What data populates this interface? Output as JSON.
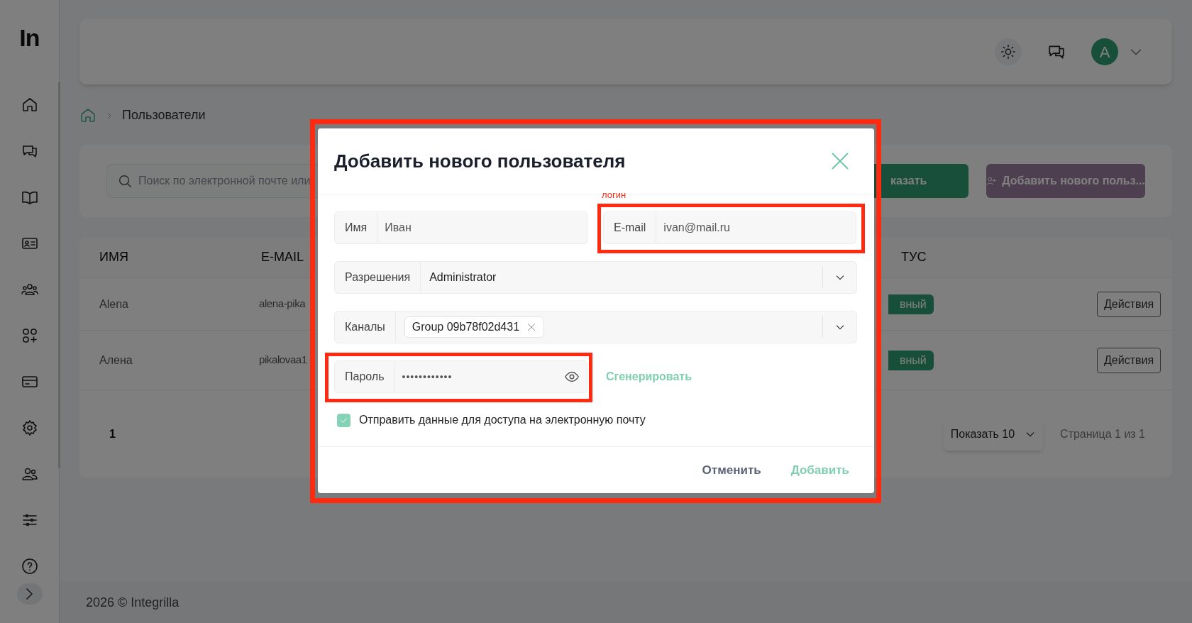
{
  "logo": "In",
  "breadcrumb": {
    "current": "Пользователи"
  },
  "filters": {
    "search_placeholder": "Поиск по электронной почте или",
    "show_button": "казать",
    "add_button": "Добавить нового польз..."
  },
  "table": {
    "columns": [
      "ИМЯ",
      "E-MAIL",
      "ТУС"
    ],
    "rows": [
      {
        "name": "Alena",
        "email": "alena-pika",
        "status": "вный",
        "action": "Действия"
      },
      {
        "name": "Алена",
        "email": "pikalovaa1",
        "status": "вный",
        "action": "Действия"
      }
    ],
    "pagination": {
      "page": "1",
      "page_size": "Показать 10",
      "page_info": "Страница 1 из 1"
    }
  },
  "header": {
    "avatar_letter": "A"
  },
  "footer": "2026 © Integrilla",
  "modal": {
    "title": "Добавить нового пользователя",
    "name": {
      "label": "Имя",
      "value": "Иван"
    },
    "email": {
      "label": "E-mail",
      "value": "ivan@mail.ru"
    },
    "permissions": {
      "label": "Разрешения",
      "value": "Administrator"
    },
    "channels": {
      "label": "Каналы",
      "tags": [
        "Group 09b78f02d431"
      ]
    },
    "password": {
      "label": "Пароль",
      "value": "••••••••••••"
    },
    "generate": "Сгенерировать",
    "send_email": {
      "label": "Отправить данные для доступа на электронную почту",
      "checked": true
    },
    "cancel": "Отменить",
    "submit": "Добавить"
  },
  "annotations": {
    "login_label": "логин"
  }
}
